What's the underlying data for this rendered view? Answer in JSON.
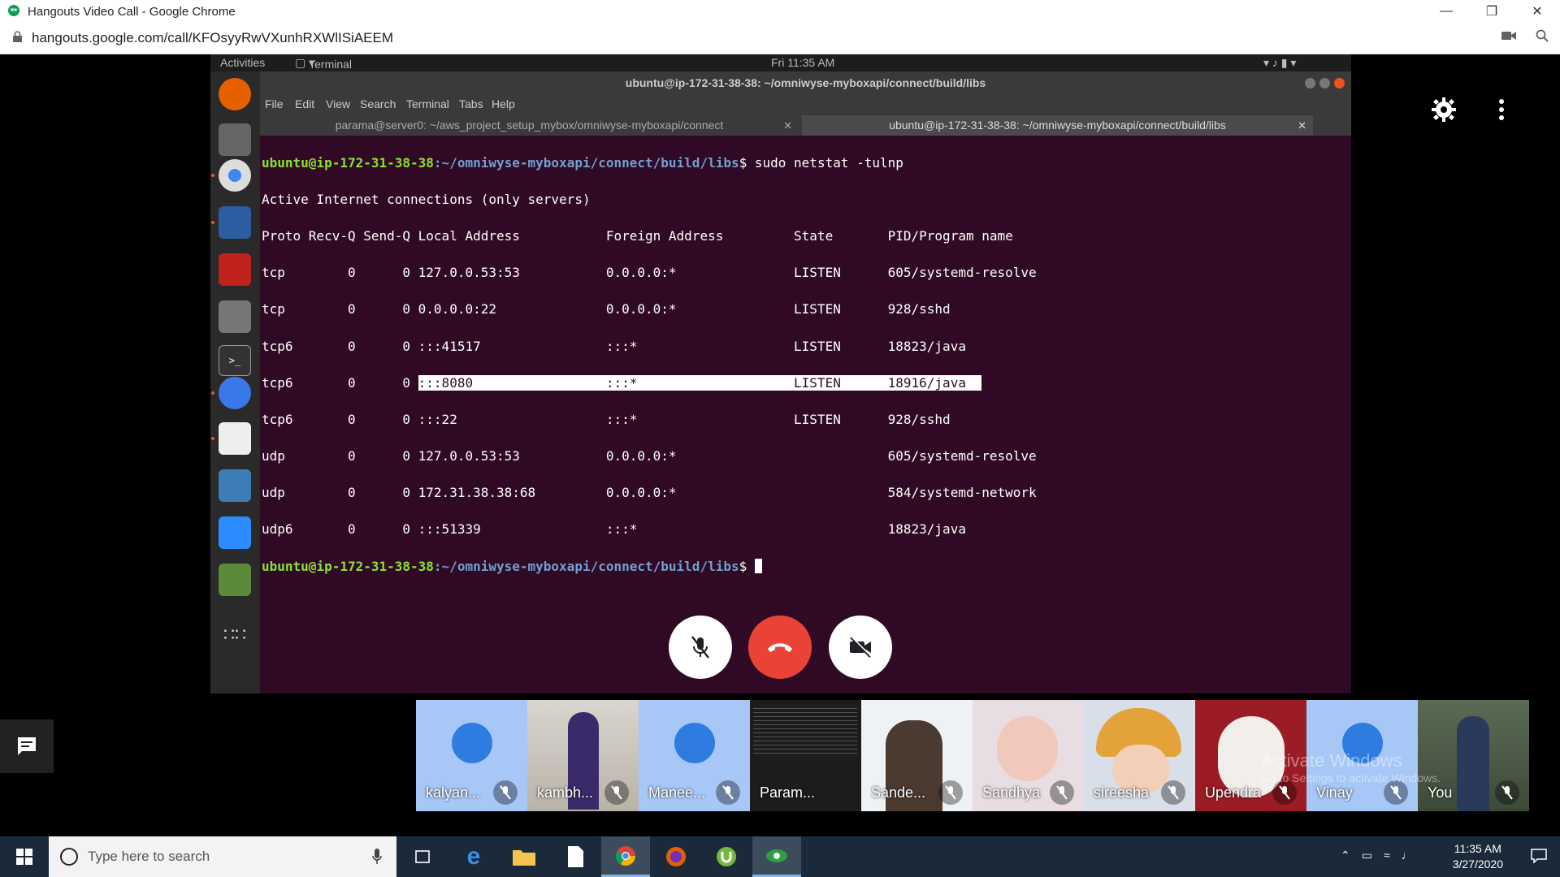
{
  "browser": {
    "title": "Hangouts Video Call - Google Chrome",
    "url": "hangouts.google.com/call/KFOsyyRwVXunhRXWlISiAEEM"
  },
  "ubuntu": {
    "activities": "Activities",
    "app_menu": "Terminal",
    "clock": "Fri 11:35 AM",
    "window_title": "ubuntu@ip-172-31-38-38: ~/omniwyse-myboxapi/connect/build/libs",
    "menu": [
      "File",
      "Edit",
      "View",
      "Search",
      "Terminal",
      "Tabs",
      "Help"
    ],
    "tabs": [
      {
        "label": "parama@server0: ~/aws_project_setup_mybox/omniwyse-myboxapi/connect"
      },
      {
        "label": "ubuntu@ip-172-31-38-38: ~/omniwyse-myboxapi/connect/build/libs"
      }
    ]
  },
  "terminal": {
    "prompt_user": "ubuntu@ip-172-31-38-38",
    "prompt_path": ":~/omniwyse-myboxapi/connect/build/libs",
    "command": "$ sudo netstat -tulnp",
    "header1": "Active Internet connections (only servers)",
    "header2": "Proto Recv-Q Send-Q Local Address           Foreign Address         State       PID/Program name",
    "rows": [
      "tcp        0      0 127.0.0.53:53           0.0.0.0:*               LISTEN      605/systemd-resolve",
      "tcp        0      0 0.0.0.0:22              0.0.0.0:*               LISTEN      928/sshd",
      "tcp6       0      0 :::41517                :::*                    LISTEN      18823/java",
      "tcp6       0      0 ",
      "tcp6       0      0 :::22                   :::*                    LISTEN      928/sshd",
      "udp        0      0 127.0.0.53:53           0.0.0.0:*                           605/systemd-resolve",
      "udp        0      0 172.31.38.38:68         0.0.0.0:*                           584/systemd-network",
      "udp6       0      0 :::51339                :::*                                18823/java"
    ],
    "highlighted_row": ":::8080                 :::*                    LISTEN      18916/java  ",
    "final_prompt_suffix": "$ "
  },
  "participants": [
    {
      "name": "kalyan...",
      "type": "avatar"
    },
    {
      "name": "kambh...",
      "type": "photo"
    },
    {
      "name": "Manee...",
      "type": "avatar"
    },
    {
      "name": "Param...",
      "type": "screen"
    },
    {
      "name": "Sande...",
      "type": "photo"
    },
    {
      "name": "Sandhya",
      "type": "photo"
    },
    {
      "name": "sireesha",
      "type": "photo"
    },
    {
      "name": "Upendra",
      "type": "photo"
    },
    {
      "name": "Vinay",
      "type": "avatar"
    },
    {
      "name": "You",
      "type": "photo"
    }
  ],
  "watermark": {
    "line1": "Activate Windows",
    "line2": "Go to Settings to activate Windows."
  },
  "taskbar": {
    "search_placeholder": "Type here to search",
    "time": "11:35 AM",
    "date": "3/27/2020"
  },
  "colors": {
    "end_call": "#ea4335",
    "terminal_bg": "#300a24",
    "prompt_green": "#8ae234",
    "prompt_blue": "#729fcf"
  }
}
